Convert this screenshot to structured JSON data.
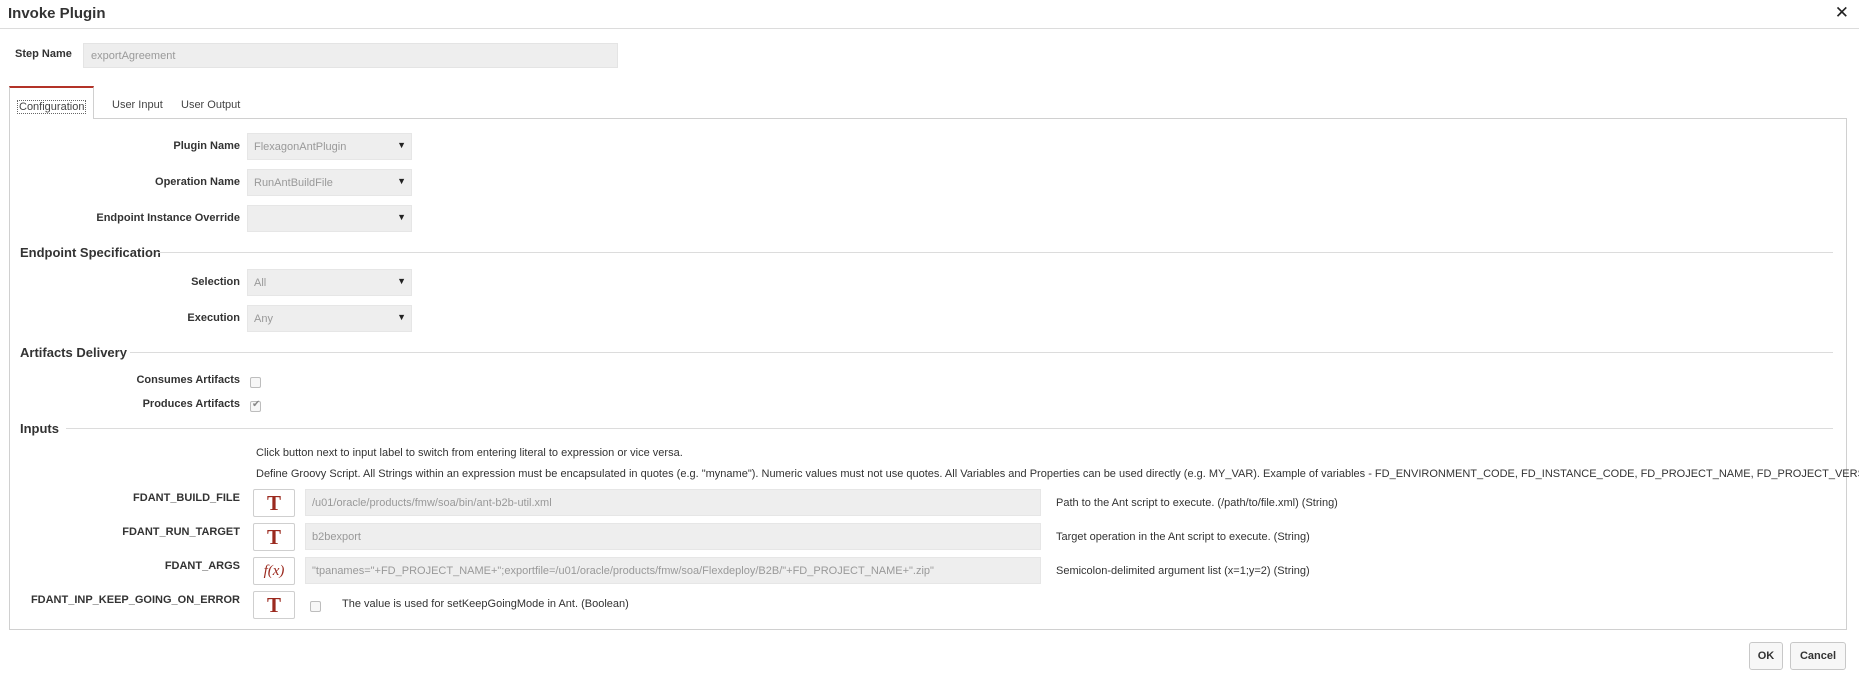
{
  "dialog": {
    "title": "Invoke Plugin",
    "close_icon": "close-icon"
  },
  "step": {
    "label": "Step Name",
    "value": "exportAgreement"
  },
  "tabs": [
    {
      "label": "Configuration",
      "active": true
    },
    {
      "label": "User Input",
      "active": false
    },
    {
      "label": "User Output",
      "active": false
    }
  ],
  "config": {
    "plugin_name": {
      "label": "Plugin Name",
      "value": "FlexagonAntPlugin"
    },
    "operation_name": {
      "label": "Operation Name",
      "value": "RunAntBuildFile"
    },
    "endpoint_override": {
      "label": "Endpoint Instance Override",
      "value": ""
    }
  },
  "endpoint_spec": {
    "title": "Endpoint Specification",
    "selection": {
      "label": "Selection",
      "value": "All"
    },
    "execution": {
      "label": "Execution",
      "value": "Any"
    }
  },
  "artifacts": {
    "title": "Artifacts Delivery",
    "consumes": {
      "label": "Consumes Artifacts",
      "checked": false
    },
    "produces": {
      "label": "Produces Artifacts",
      "checked": true
    }
  },
  "inputs": {
    "title": "Inputs",
    "help1": "Click button next to input label to switch from entering literal to expression or vice versa.",
    "help2": "Define Groovy Script. All Strings within an expression must be encapsulated in quotes (e.g. \"myname\"). Numeric values must not use quotes. All Variables and Properties can be used directly (e.g. MY_VAR). Example of variables - FD_ENVIRONMENT_CODE, FD_INSTANCE_CODE, FD_PROJECT_NAME, FD_PROJECT_VERSION",
    "rows": [
      {
        "label": "FDANT_BUILD_FILE",
        "mode": "T",
        "value": "/u01/oracle/products/fmw/soa/bin/ant-b2b-util.xml",
        "desc": "Path to the Ant script to execute. (/path/to/file.xml) (String)"
      },
      {
        "label": "FDANT_RUN_TARGET",
        "mode": "T",
        "value": "b2bexport",
        "desc": "Target operation in the Ant script to execute. (String)"
      },
      {
        "label": "FDANT_ARGS",
        "mode": "f(x)",
        "value": "\"tpanames=\"+FD_PROJECT_NAME+\";exportfile=/u01/oracle/products/fmw/soa/Flexdeploy/B2B/\"+FD_PROJECT_NAME+\".zip\"",
        "desc": "Semicolon-delimited argument list (x=1;y=2) (String)"
      },
      {
        "label": "FDANT_INP_KEEP_GOING_ON_ERROR",
        "mode": "T",
        "checked": false,
        "desc": "The value is used for setKeepGoingMode in Ant. (Boolean)"
      }
    ]
  },
  "footer": {
    "ok": "OK",
    "cancel": "Cancel"
  }
}
